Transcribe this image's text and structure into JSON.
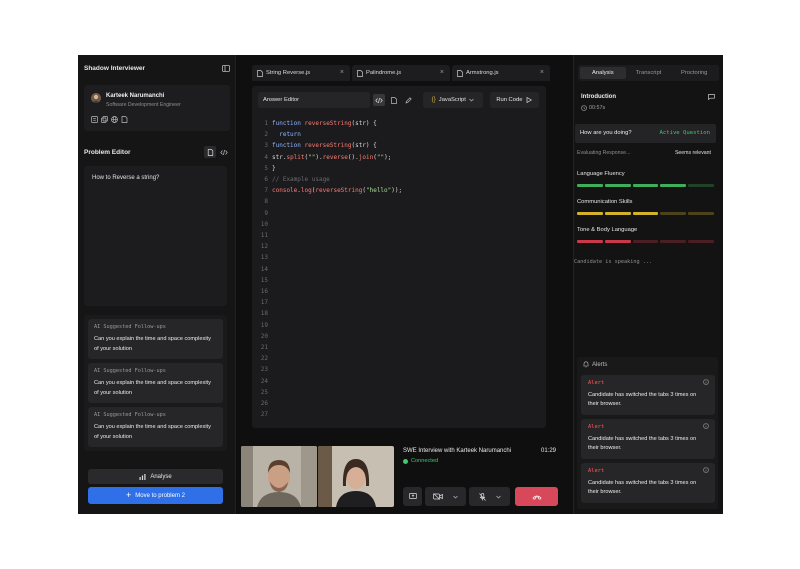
{
  "sidebar": {
    "title": "Shadow Interviewer",
    "profile": {
      "name": "Karteek Narumanchi",
      "role": "Software Development Engineer"
    },
    "profile_icons": [
      "resume-icon",
      "copy-icon",
      "globe-icon",
      "document-icon"
    ],
    "problem_editor": {
      "title": "Problem Editor",
      "question": "How to Reverse a string?"
    },
    "followups": [
      {
        "heading": "AI Suggested Follow-ups",
        "text": "Can you explain the time and space complexity of your solution"
      },
      {
        "heading": "AI Suggested Follow-ups",
        "text": "Can you explain the time and space complexity of your solution"
      },
      {
        "heading": "AI Suggested Follow-ups",
        "text": "Can you explain the time and space complexity of your solution"
      }
    ],
    "analyse_label": "Analyse",
    "move_label": "Move to problem 2"
  },
  "tabs": [
    {
      "label": "String Reverse.js"
    },
    {
      "label": "Palindrome.js"
    },
    {
      "label": "Armstrong.js"
    }
  ],
  "editor": {
    "name": "Answer Editor",
    "language": "JavaScript",
    "run_label": "Run Code",
    "line_count": 27,
    "lines": [
      "function reverseString(str) {",
      "  return",
      "function reverseString(str) {",
      "str.split(\"\").reverse().join(\"\");",
      "}",
      "// Example usage",
      "console.log(reverseString(\"hello\"));"
    ]
  },
  "call": {
    "title": "SWE Interview with Karteek Narumanchi",
    "time": "01:29",
    "status": "Connected"
  },
  "analysis": {
    "tabs": [
      "Analysis",
      "Transcript",
      "Proctoring"
    ],
    "active_tab": "Analysis",
    "section": "Introduction",
    "section_time": "00:57s",
    "question": "How are you doing?",
    "question_status": "Active Question",
    "evaluating": "Evaluating Response...",
    "verdict": "Seems relevant",
    "metrics": [
      {
        "label": "Language Fluency",
        "filled": 4,
        "total": 5,
        "color": "#3fae5a"
      },
      {
        "label": "Communication Skills",
        "filled": 3,
        "total": 5,
        "color": "#d4b12a"
      },
      {
        "label": "Tone & Body Language",
        "filled": 2,
        "total": 5,
        "color": "#c9394a"
      }
    ],
    "speaking": "Candidate is speaking ..."
  },
  "alerts": {
    "title": "Alerts",
    "items": [
      {
        "type": "Alert",
        "text": "Candidate has switched the tabs 3 times on their browser."
      },
      {
        "type": "Alert",
        "text": "Candidate has switched the tabs 3 times on their browser."
      },
      {
        "type": "Alert",
        "text": "Candidate has switched the tabs 3 times on their browser."
      }
    ]
  },
  "colors": {
    "accent": "#2f6fe8",
    "success": "#3ec96f",
    "danger": "#ff5a5a",
    "end_call": "#d7485a"
  }
}
